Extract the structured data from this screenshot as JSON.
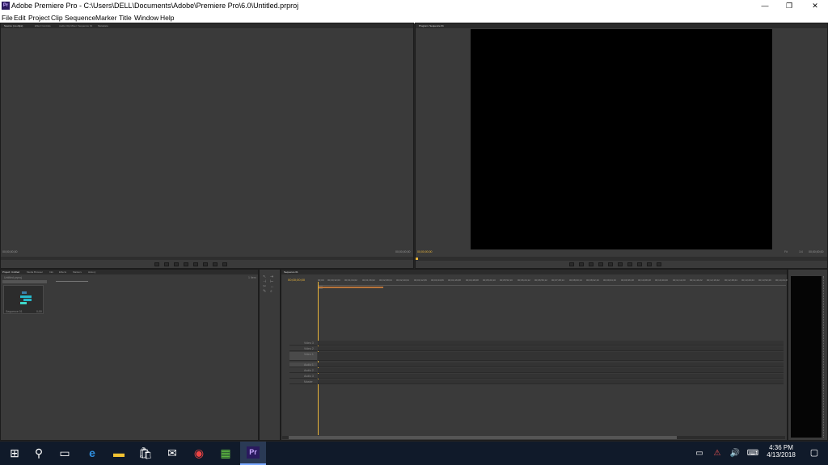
{
  "window": {
    "title": "Adobe Premiere Pro - C:\\Users\\DELL\\Documents\\Adobe\\Premiere Pro\\6.0\\Untitled.prproj",
    "app_icon": "Pr",
    "minimize": "—",
    "restore": "❐",
    "close": "✕"
  },
  "menu": [
    "File",
    "Edit",
    "Project",
    "Clip",
    "Sequence",
    "Marker",
    "Title",
    "Window",
    "Help"
  ],
  "source_panel": {
    "tabs": [
      "Source: (no clips)",
      "Effect Controls",
      "Audio Clip Mixer: Sequence 01",
      "Metadata"
    ],
    "timecode_left": "00;00;00;00",
    "timecode_right": "00;00;00;00"
  },
  "program_panel": {
    "tab": "Program: Sequence 01",
    "timecode_left": "00;00;00;00",
    "fit_label": "Fit",
    "fraction": "1/4",
    "timecode_right": "00;00;00;00"
  },
  "project_panel": {
    "tabs": [
      "Project: Untitled",
      "Media Browser",
      "Info",
      "Effects",
      "Markers",
      "History"
    ],
    "file_name": "Untitled.prproj",
    "items_count": "1 Item",
    "item_name": "Sequence 01",
    "item_duration": "0;00"
  },
  "timeline_panel": {
    "tab": "Sequence 01",
    "timecode": "00;00;00;00",
    "ruler": [
      "00;00",
      "00;00;32;00",
      "00;01;04;02",
      "00;01;36;02",
      "00;02;08;04",
      "00;02;40;04",
      "00;03;12;06",
      "00;03;44;06",
      "00;04;16;08",
      "00;04;48;08",
      "00;05;20;10",
      "00;05;52;10",
      "00;06;24;12",
      "00;06;56;12",
      "00;07;28;14",
      "00;08;00;14",
      "00;08;32;16",
      "00;09;04;16",
      "00;09;36;18",
      "00;10;08;18",
      "00;10;40;20",
      "00;11;12;20",
      "00;11;44;22",
      "00;12;16;22",
      "00;12;48;24",
      "00;13;20;24",
      "00;13;52;26",
      "00;14;24;26",
      "00;14;56;28",
      "00;15;28;28",
      "00;16;00"
    ],
    "tracks": [
      "Video 3",
      "Video 2",
      "Video 1",
      "Audio 1",
      "Audio 2",
      "Audio 3",
      "Master"
    ]
  },
  "taskbar": {
    "time": "4:36 PM",
    "date": "4/13/2018",
    "active_app": "Pr"
  },
  "colors": {
    "accent_timecode": "#e8b43a",
    "premiere_purple": "#2a1a5e",
    "taskbar": "#101a2a"
  }
}
